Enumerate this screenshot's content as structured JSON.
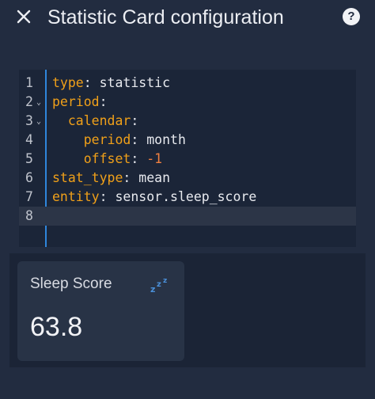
{
  "dialog": {
    "title": "Statistic Card configuration",
    "help_label": "?"
  },
  "icons": {
    "close": "close-icon",
    "help": "help-circle-icon",
    "sleep": "sleep-icon",
    "fold": "chevron-down-icon"
  },
  "editor": {
    "fold_glyph": "⌄",
    "lines": [
      {
        "num": "1",
        "parts": [
          {
            "t": "type",
            "c": "key"
          },
          {
            "t": ": ",
            "c": "val"
          },
          {
            "t": "statistic",
            "c": "val"
          }
        ]
      },
      {
        "num": "2",
        "fold": true,
        "parts": [
          {
            "t": "period",
            "c": "key"
          },
          {
            "t": ":",
            "c": "val"
          }
        ]
      },
      {
        "num": "3",
        "fold": true,
        "parts": [
          {
            "t": "  ",
            "c": "val"
          },
          {
            "t": "calendar",
            "c": "key"
          },
          {
            "t": ":",
            "c": "val"
          }
        ]
      },
      {
        "num": "4",
        "parts": [
          {
            "t": "    ",
            "c": "val"
          },
          {
            "t": "period",
            "c": "key"
          },
          {
            "t": ": ",
            "c": "val"
          },
          {
            "t": "month",
            "c": "val"
          }
        ]
      },
      {
        "num": "5",
        "parts": [
          {
            "t": "    ",
            "c": "val"
          },
          {
            "t": "offset",
            "c": "key"
          },
          {
            "t": ": ",
            "c": "val"
          },
          {
            "t": "-1",
            "c": "num"
          }
        ]
      },
      {
        "num": "6",
        "parts": [
          {
            "t": "stat_type",
            "c": "key"
          },
          {
            "t": ": ",
            "c": "val"
          },
          {
            "t": "mean",
            "c": "val"
          }
        ]
      },
      {
        "num": "7",
        "parts": [
          {
            "t": "entity",
            "c": "key"
          },
          {
            "t": ": ",
            "c": "val"
          },
          {
            "t": "sensor.sleep_score",
            "c": "val"
          }
        ]
      },
      {
        "num": "8",
        "active": true,
        "parts": []
      }
    ]
  },
  "card": {
    "name": "Sleep Score",
    "value": "63.8"
  },
  "colors": {
    "background": "#222c40",
    "editor_background": "#1b2538",
    "card_background": "#283346",
    "yaml_key": "#f0a019",
    "yaml_number": "#f08040",
    "accent": "#2f86dc",
    "sleep_icon": "#4a90d9"
  }
}
